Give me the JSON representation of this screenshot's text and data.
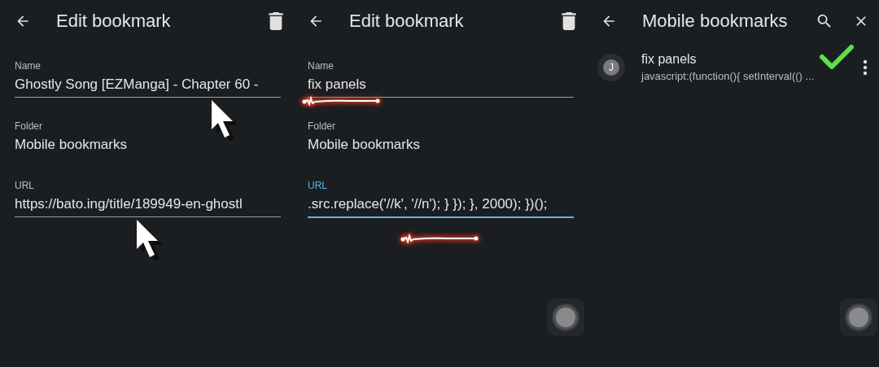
{
  "panels": [
    {
      "kind": "edit",
      "title": "Edit bookmark",
      "floating_button": false,
      "fields": [
        {
          "label": "Name",
          "value": "Ghostly Song [EZManga] - Chapter 60 -",
          "focused": false,
          "annotations": [
            {
              "kind": "cursor"
            }
          ]
        },
        {
          "label": "Folder",
          "value": "Mobile bookmarks",
          "focused": false
        },
        {
          "label": "URL",
          "value": "https://bato.ing/title/189949-en-ghostl",
          "focused": false,
          "annotations": [
            {
              "kind": "cursor"
            }
          ]
        }
      ]
    },
    {
      "kind": "edit",
      "title": "Edit bookmark",
      "floating_button": true,
      "fields": [
        {
          "label": "Name",
          "value": "fix panels",
          "focused": false,
          "annotations": [
            {
              "kind": "scribble"
            }
          ]
        },
        {
          "label": "Folder",
          "value": "Mobile bookmarks",
          "focused": false
        },
        {
          "label": "URL",
          "value": ".src.replace('//k', '//n'); } }); }, 2000); })();",
          "focused": true,
          "annotations": [
            {
              "kind": "scribble"
            }
          ]
        }
      ]
    },
    {
      "kind": "list",
      "title": "Mobile bookmarks",
      "floating_button": true,
      "items": [
        {
          "avatar": "J",
          "title": "fix panels",
          "subtitle": "javascript:(function(){ setInterval(() ...",
          "annotations": [
            {
              "kind": "check"
            }
          ]
        }
      ]
    }
  ]
}
